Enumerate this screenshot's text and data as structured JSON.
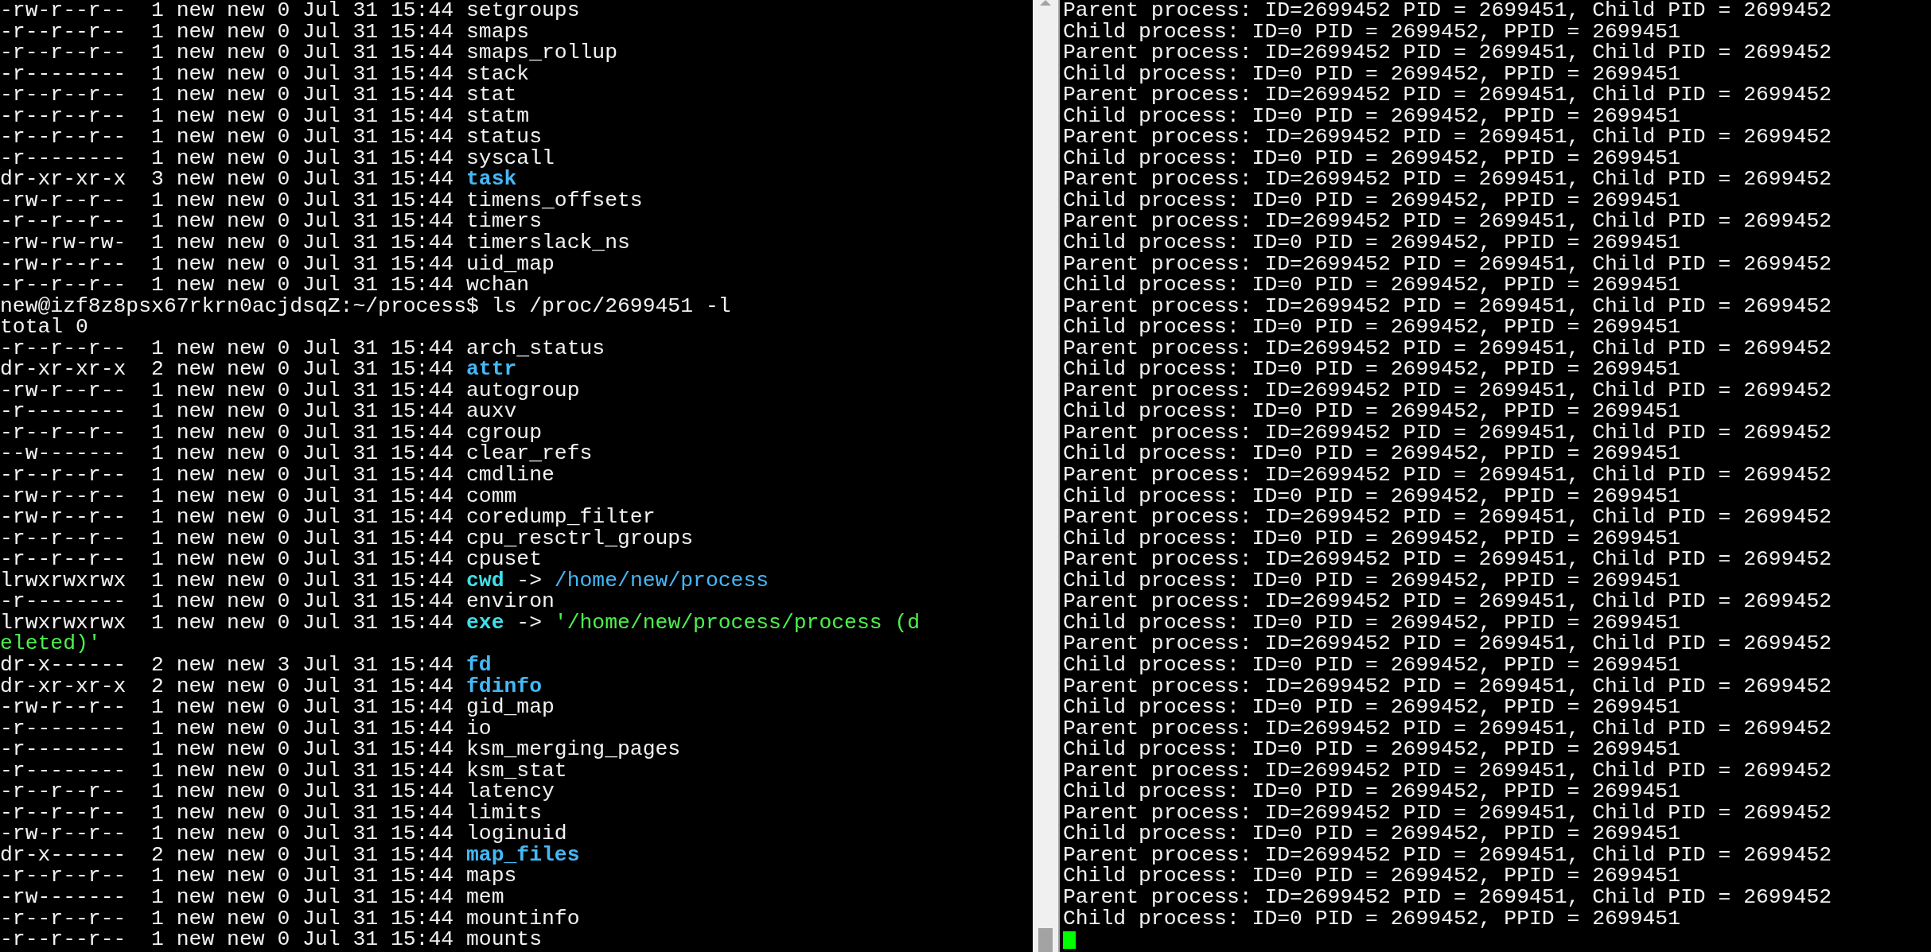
{
  "left_terminal": {
    "lines": [
      {
        "kind": "file",
        "perms": "-rw-r--r--",
        "links": "1",
        "owner": "new",
        "group": "new",
        "size": "0",
        "date": "Jul 31 15:44",
        "name": "setgroups"
      },
      {
        "kind": "file",
        "perms": "-r--r--r--",
        "links": "1",
        "owner": "new",
        "group": "new",
        "size": "0",
        "date": "Jul 31 15:44",
        "name": "smaps"
      },
      {
        "kind": "file",
        "perms": "-r--r--r--",
        "links": "1",
        "owner": "new",
        "group": "new",
        "size": "0",
        "date": "Jul 31 15:44",
        "name": "smaps_rollup"
      },
      {
        "kind": "file",
        "perms": "-r--------",
        "links": "1",
        "owner": "new",
        "group": "new",
        "size": "0",
        "date": "Jul 31 15:44",
        "name": "stack"
      },
      {
        "kind": "file",
        "perms": "-r--r--r--",
        "links": "1",
        "owner": "new",
        "group": "new",
        "size": "0",
        "date": "Jul 31 15:44",
        "name": "stat"
      },
      {
        "kind": "file",
        "perms": "-r--r--r--",
        "links": "1",
        "owner": "new",
        "group": "new",
        "size": "0",
        "date": "Jul 31 15:44",
        "name": "statm"
      },
      {
        "kind": "file",
        "perms": "-r--r--r--",
        "links": "1",
        "owner": "new",
        "group": "new",
        "size": "0",
        "date": "Jul 31 15:44",
        "name": "status"
      },
      {
        "kind": "file",
        "perms": "-r--------",
        "links": "1",
        "owner": "new",
        "group": "new",
        "size": "0",
        "date": "Jul 31 15:44",
        "name": "syscall"
      },
      {
        "kind": "dir",
        "perms": "dr-xr-xr-x",
        "links": "3",
        "owner": "new",
        "group": "new",
        "size": "0",
        "date": "Jul 31 15:44",
        "name": "task"
      },
      {
        "kind": "file",
        "perms": "-rw-r--r--",
        "links": "1",
        "owner": "new",
        "group": "new",
        "size": "0",
        "date": "Jul 31 15:44",
        "name": "timens_offsets"
      },
      {
        "kind": "file",
        "perms": "-r--r--r--",
        "links": "1",
        "owner": "new",
        "group": "new",
        "size": "0",
        "date": "Jul 31 15:44",
        "name": "timers"
      },
      {
        "kind": "file",
        "perms": "-rw-rw-rw-",
        "links": "1",
        "owner": "new",
        "group": "new",
        "size": "0",
        "date": "Jul 31 15:44",
        "name": "timerslack_ns"
      },
      {
        "kind": "file",
        "perms": "-rw-r--r--",
        "links": "1",
        "owner": "new",
        "group": "new",
        "size": "0",
        "date": "Jul 31 15:44",
        "name": "uid_map"
      },
      {
        "kind": "file",
        "perms": "-r--r--r--",
        "links": "1",
        "owner": "new",
        "group": "new",
        "size": "0",
        "date": "Jul 31 15:44",
        "name": "wchan"
      },
      {
        "kind": "prompt",
        "prompt": "new@izf8z8psx67rkrn0acjdsqZ:~/process$",
        "command": "ls /proc/2699451 -l"
      },
      {
        "kind": "plain",
        "text": "total 0"
      },
      {
        "kind": "file",
        "perms": "-r--r--r--",
        "links": "1",
        "owner": "new",
        "group": "new",
        "size": "0",
        "date": "Jul 31 15:44",
        "name": "arch_status"
      },
      {
        "kind": "dir",
        "perms": "dr-xr-xr-x",
        "links": "2",
        "owner": "new",
        "group": "new",
        "size": "0",
        "date": "Jul 31 15:44",
        "name": "attr"
      },
      {
        "kind": "file",
        "perms": "-rw-r--r--",
        "links": "1",
        "owner": "new",
        "group": "new",
        "size": "0",
        "date": "Jul 31 15:44",
        "name": "autogroup"
      },
      {
        "kind": "file",
        "perms": "-r--------",
        "links": "1",
        "owner": "new",
        "group": "new",
        "size": "0",
        "date": "Jul 31 15:44",
        "name": "auxv"
      },
      {
        "kind": "file",
        "perms": "-r--r--r--",
        "links": "1",
        "owner": "new",
        "group": "new",
        "size": "0",
        "date": "Jul 31 15:44",
        "name": "cgroup"
      },
      {
        "kind": "file",
        "perms": "--w-------",
        "links": "1",
        "owner": "new",
        "group": "new",
        "size": "0",
        "date": "Jul 31 15:44",
        "name": "clear_refs"
      },
      {
        "kind": "file",
        "perms": "-r--r--r--",
        "links": "1",
        "owner": "new",
        "group": "new",
        "size": "0",
        "date": "Jul 31 15:44",
        "name": "cmdline"
      },
      {
        "kind": "file",
        "perms": "-rw-r--r--",
        "links": "1",
        "owner": "new",
        "group": "new",
        "size": "0",
        "date": "Jul 31 15:44",
        "name": "comm"
      },
      {
        "kind": "file",
        "perms": "-rw-r--r--",
        "links": "1",
        "owner": "new",
        "group": "new",
        "size": "0",
        "date": "Jul 31 15:44",
        "name": "coredump_filter"
      },
      {
        "kind": "file",
        "perms": "-r--r--r--",
        "links": "1",
        "owner": "new",
        "group": "new",
        "size": "0",
        "date": "Jul 31 15:44",
        "name": "cpu_resctrl_groups"
      },
      {
        "kind": "file",
        "perms": "-r--r--r--",
        "links": "1",
        "owner": "new",
        "group": "new",
        "size": "0",
        "date": "Jul 31 15:44",
        "name": "cpuset"
      },
      {
        "kind": "symlink",
        "perms": "lrwxrwxrwx",
        "links": "1",
        "owner": "new",
        "group": "new",
        "size": "0",
        "date": "Jul 31 15:44",
        "name": "cwd",
        "arrow": "->",
        "target": {
          "text": "/home/new/process",
          "color": "#45b8f5"
        }
      },
      {
        "kind": "file",
        "perms": "-r--------",
        "links": "1",
        "owner": "new",
        "group": "new",
        "size": "0",
        "date": "Jul 31 15:44",
        "name": "environ"
      },
      {
        "kind": "symlink",
        "perms": "lrwxrwxrwx",
        "links": "1",
        "owner": "new",
        "group": "new",
        "size": "0",
        "date": "Jul 31 15:44",
        "name": "exe",
        "arrow": "->",
        "target": {
          "text": "'/home/new/process/process (d",
          "color": "#4cf04c"
        }
      },
      {
        "kind": "wrap",
        "text": "eleted)'",
        "color": "#4cf04c"
      },
      {
        "kind": "dir",
        "perms": "dr-x------",
        "links": "2",
        "owner": "new",
        "group": "new",
        "size": "3",
        "date": "Jul 31 15:44",
        "name": "fd"
      },
      {
        "kind": "dir",
        "perms": "dr-xr-xr-x",
        "links": "2",
        "owner": "new",
        "group": "new",
        "size": "0",
        "date": "Jul 31 15:44",
        "name": "fdinfo"
      },
      {
        "kind": "file",
        "perms": "-rw-r--r--",
        "links": "1",
        "owner": "new",
        "group": "new",
        "size": "0",
        "date": "Jul 31 15:44",
        "name": "gid_map"
      },
      {
        "kind": "file",
        "perms": "-r--------",
        "links": "1",
        "owner": "new",
        "group": "new",
        "size": "0",
        "date": "Jul 31 15:44",
        "name": "io"
      },
      {
        "kind": "file",
        "perms": "-r--------",
        "links": "1",
        "owner": "new",
        "group": "new",
        "size": "0",
        "date": "Jul 31 15:44",
        "name": "ksm_merging_pages"
      },
      {
        "kind": "file",
        "perms": "-r--------",
        "links": "1",
        "owner": "new",
        "group": "new",
        "size": "0",
        "date": "Jul 31 15:44",
        "name": "ksm_stat"
      },
      {
        "kind": "file",
        "perms": "-r--r--r--",
        "links": "1",
        "owner": "new",
        "group": "new",
        "size": "0",
        "date": "Jul 31 15:44",
        "name": "latency"
      },
      {
        "kind": "file",
        "perms": "-r--r--r--",
        "links": "1",
        "owner": "new",
        "group": "new",
        "size": "0",
        "date": "Jul 31 15:44",
        "name": "limits"
      },
      {
        "kind": "file",
        "perms": "-rw-r--r--",
        "links": "1",
        "owner": "new",
        "group": "new",
        "size": "0",
        "date": "Jul 31 15:44",
        "name": "loginuid"
      },
      {
        "kind": "dir",
        "perms": "dr-x------",
        "links": "2",
        "owner": "new",
        "group": "new",
        "size": "0",
        "date": "Jul 31 15:44",
        "name": "map_files"
      },
      {
        "kind": "file",
        "perms": "-r--r--r--",
        "links": "1",
        "owner": "new",
        "group": "new",
        "size": "0",
        "date": "Jul 31 15:44",
        "name": "maps"
      },
      {
        "kind": "file",
        "perms": "-rw-------",
        "links": "1",
        "owner": "new",
        "group": "new",
        "size": "0",
        "date": "Jul 31 15:44",
        "name": "mem"
      },
      {
        "kind": "file",
        "perms": "-r--r--r--",
        "links": "1",
        "owner": "new",
        "group": "new",
        "size": "0",
        "date": "Jul 31 15:44",
        "name": "mountinfo"
      },
      {
        "kind": "file",
        "perms": "-r--r--r--",
        "links": "1",
        "owner": "new",
        "group": "new",
        "size": "0",
        "date": "Jul 31 15:44",
        "name": "mounts"
      }
    ]
  },
  "right_terminal": {
    "lines": [
      {
        "text": "Parent process: ID=2699452 PID = 2699451, Child PID = 2699452"
      },
      {
        "text": "Child process: ID=0 PID = 2699452, PPID = 2699451"
      },
      {
        "text": "Parent process: ID=2699452 PID = 2699451, Child PID = 2699452"
      },
      {
        "text": "Child process: ID=0 PID = 2699452, PPID = 2699451"
      },
      {
        "text": "Parent process: ID=2699452 PID = 2699451, Child PID = 2699452"
      },
      {
        "text": "Child process: ID=0 PID = 2699452, PPID = 2699451"
      },
      {
        "text": "Parent process: ID=2699452 PID = 2699451, Child PID = 2699452"
      },
      {
        "text": "Child process: ID=0 PID = 2699452, PPID = 2699451"
      },
      {
        "text": "Parent process: ID=2699452 PID = 2699451, Child PID = 2699452"
      },
      {
        "text": "Child process: ID=0 PID = 2699452, PPID = 2699451"
      },
      {
        "text": "Parent process: ID=2699452 PID = 2699451, Child PID = 2699452"
      },
      {
        "text": "Child process: ID=0 PID = 2699452, PPID = 2699451"
      },
      {
        "text": "Parent process: ID=2699452 PID = 2699451, Child PID = 2699452"
      },
      {
        "text": "Child process: ID=0 PID = 2699452, PPID = 2699451"
      },
      {
        "text": "Parent process: ID=2699452 PID = 2699451, Child PID = 2699452"
      },
      {
        "text": "Child process: ID=0 PID = 2699452, PPID = 2699451"
      },
      {
        "text": "Parent process: ID=2699452 PID = 2699451, Child PID = 2699452"
      },
      {
        "text": "Child process: ID=0 PID = 2699452, PPID = 2699451"
      },
      {
        "text": "Parent process: ID=2699452 PID = 2699451, Child PID = 2699452"
      },
      {
        "text": "Child process: ID=0 PID = 2699452, PPID = 2699451"
      },
      {
        "text": "Parent process: ID=2699452 PID = 2699451, Child PID = 2699452"
      },
      {
        "text": "Child process: ID=0 PID = 2699452, PPID = 2699451"
      },
      {
        "text": "Parent process: ID=2699452 PID = 2699451, Child PID = 2699452"
      },
      {
        "text": "Child process: ID=0 PID = 2699452, PPID = 2699451"
      },
      {
        "text": "Parent process: ID=2699452 PID = 2699451, Child PID = 2699452"
      },
      {
        "text": "Child process: ID=0 PID = 2699452, PPID = 2699451"
      },
      {
        "text": "Parent process: ID=2699452 PID = 2699451, Child PID = 2699452"
      },
      {
        "text": "Child process: ID=0 PID = 2699452, PPID = 2699451"
      },
      {
        "text": "Parent process: ID=2699452 PID = 2699451, Child PID = 2699452"
      },
      {
        "text": "Child process: ID=0 PID = 2699452, PPID = 2699451"
      },
      {
        "text": "Parent process: ID=2699452 PID = 2699451, Child PID = 2699452"
      },
      {
        "text": "Child process: ID=0 PID = 2699452, PPID = 2699451"
      },
      {
        "text": "Parent process: ID=2699452 PID = 2699451, Child PID = 2699452"
      },
      {
        "text": "Child process: ID=0 PID = 2699452, PPID = 2699451"
      },
      {
        "text": "Parent process: ID=2699452 PID = 2699451, Child PID = 2699452"
      },
      {
        "text": "Child process: ID=0 PID = 2699452, PPID = 2699451"
      },
      {
        "text": "Parent process: ID=2699452 PID = 2699451, Child PID = 2699452"
      },
      {
        "text": "Child process: ID=0 PID = 2699452, PPID = 2699451"
      },
      {
        "text": "Parent process: ID=2699452 PID = 2699451, Child PID = 2699452"
      },
      {
        "text": "Child process: ID=0 PID = 2699452, PPID = 2699451"
      },
      {
        "text": "Parent process: ID=2699452 PID = 2699451, Child PID = 2699452"
      },
      {
        "text": "Child process: ID=0 PID = 2699452, PPID = 2699451"
      },
      {
        "text": "Parent process: ID=2699452 PID = 2699451, Child PID = 2699452"
      },
      {
        "text": "Child process: ID=0 PID = 2699452, PPID = 2699451"
      }
    ]
  }
}
